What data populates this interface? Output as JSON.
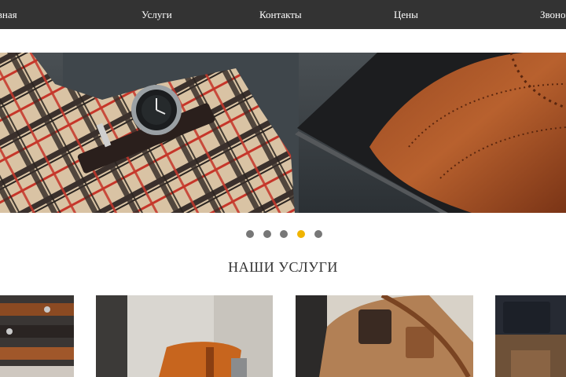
{
  "nav": {
    "items": [
      {
        "label": "Главная"
      },
      {
        "label": "Услуги"
      },
      {
        "label": "Контакты"
      },
      {
        "label": "Цены"
      },
      {
        "label": "Звонок"
      }
    ]
  },
  "slider": {
    "slide_count": 5,
    "active_index": 3,
    "active_color": "#f0b400",
    "inactive_color": "#777777"
  },
  "services": {
    "title": "НАШИ УСЛУГИ"
  },
  "colors": {
    "navbar": "#333333",
    "nav_text": "#ffffff",
    "heading": "#333333"
  }
}
